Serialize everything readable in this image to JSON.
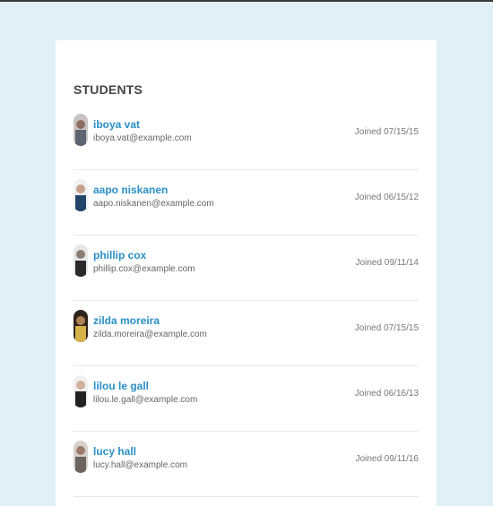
{
  "page": {
    "title": "STUDENTS"
  },
  "students": [
    {
      "name": "iboya vat",
      "email": "iboya.vat@example.com",
      "joined": "Joined 07/15/15",
      "avatar": "avatar-photo"
    },
    {
      "name": "aapo niskanen",
      "email": "aapo.niskanen@example.com",
      "joined": "Joined 06/15/12",
      "avatar": "avatar-photo"
    },
    {
      "name": "phillip cox",
      "email": "phillip.cox@example.com",
      "joined": "Joined 09/11/14",
      "avatar": "avatar-photo"
    },
    {
      "name": "zilda moreira",
      "email": "zilda.moreira@example.com",
      "joined": "Joined 07/15/15",
      "avatar": "avatar-photo"
    },
    {
      "name": "lilou le gall",
      "email": "lilou.le.gall@example.com",
      "joined": "Joined 06/16/13",
      "avatar": "avatar-photo"
    },
    {
      "name": "lucy hall",
      "email": "lucy.hall@example.com",
      "joined": "Joined 09/11/16",
      "avatar": "avatar-photo"
    }
  ],
  "colors": {
    "background": "#e1f0f6",
    "card": "#ffffff",
    "link": "#2a8fc7",
    "title": "#444444"
  }
}
